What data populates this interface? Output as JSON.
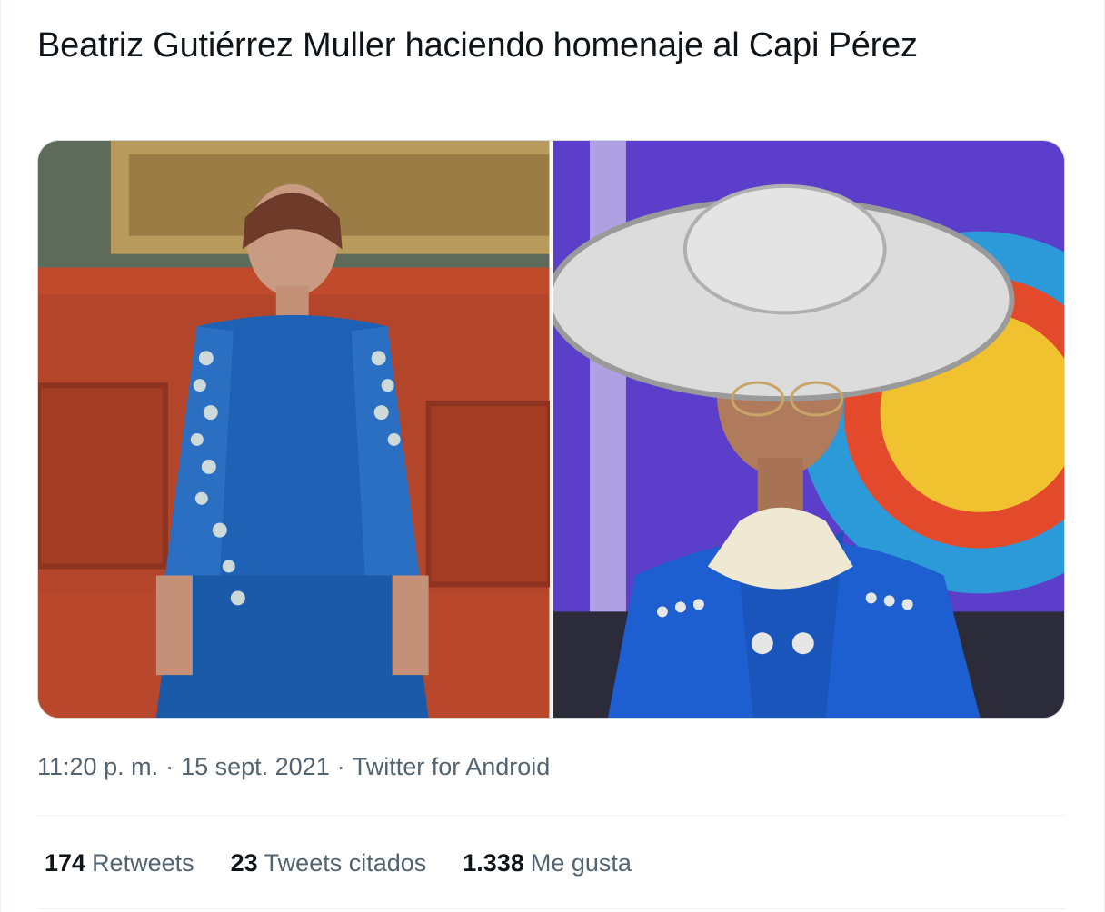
{
  "tweet": {
    "text": "Beatriz Gutiérrez Muller haciendo homenaje al Capi Pérez",
    "media": [
      {
        "name": "photo-left",
        "alt": ""
      },
      {
        "name": "photo-right",
        "alt": ""
      }
    ],
    "meta": {
      "time": "11:20 p. m.",
      "separator": "·",
      "date": "15 sept. 2021",
      "source": "Twitter for Android"
    },
    "stats": {
      "retweets": {
        "count": "174",
        "label": "Retweets"
      },
      "quotes": {
        "count": "23",
        "label": "Tweets citados"
      },
      "likes": {
        "count": "1.338",
        "label": "Me gusta"
      }
    }
  },
  "colors": {
    "text_primary": "#0f1419",
    "text_secondary": "#536471",
    "border": "#cfd9de",
    "divider": "#eff3f4"
  }
}
